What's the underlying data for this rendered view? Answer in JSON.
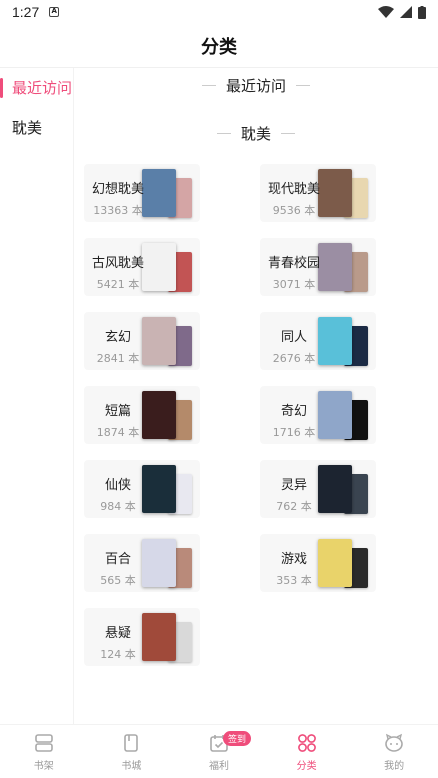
{
  "status_bar": {
    "time": "1:27",
    "notification_icon": "A"
  },
  "header": {
    "title": "分类"
  },
  "sidebar": {
    "items": [
      {
        "label": "最近访问",
        "active": true
      },
      {
        "label": "耽美",
        "active": false
      }
    ]
  },
  "sections": {
    "recent": {
      "title": "最近访问"
    },
    "danmei": {
      "title": "耽美"
    }
  },
  "categories": [
    {
      "name": "幻想耽美",
      "count": "13363 本",
      "front": "#5a7fa8",
      "back": "#d4a5a5"
    },
    {
      "name": "现代耽美",
      "count": "9536 本",
      "front": "#7c5b4a",
      "back": "#e8d7b0"
    },
    {
      "name": "古风耽美",
      "count": "5421 本",
      "front": "#f2f2f2",
      "back": "#c25454"
    },
    {
      "name": "青春校园",
      "count": "3071 本",
      "front": "#9b8ea3",
      "back": "#b99a8a"
    },
    {
      "name": "玄幻",
      "count": "2841 本",
      "front": "#c9b3b3",
      "back": "#7f6a8a"
    },
    {
      "name": "同人",
      "count": "2676 本",
      "front": "#59c0d9",
      "back": "#1b2a44"
    },
    {
      "name": "短篇",
      "count": "1874 本",
      "front": "#3a1d1d",
      "back": "#b48a6a"
    },
    {
      "name": "奇幻",
      "count": "1716 本",
      "front": "#8fa6c9",
      "back": "#111111"
    },
    {
      "name": "仙侠",
      "count": "984 本",
      "front": "#1a2e3a",
      "back": "#e8e8f0"
    },
    {
      "name": "灵异",
      "count": "762 本",
      "front": "#1c2430",
      "back": "#3a4450"
    },
    {
      "name": "百合",
      "count": "565 本",
      "front": "#d6d8e8",
      "back": "#b98a7a"
    },
    {
      "name": "游戏",
      "count": "353 本",
      "front": "#e9d36a",
      "back": "#2a2a2a"
    },
    {
      "name": "悬疑",
      "count": "124 本",
      "front": "#a04a3a",
      "back": "#d9d9d9"
    }
  ],
  "tabbar": {
    "items": [
      {
        "label": "书架",
        "icon": "bookshelf-icon",
        "active": false
      },
      {
        "label": "书城",
        "icon": "book-icon",
        "active": false
      },
      {
        "label": "福利",
        "icon": "calendar-check-icon",
        "active": false,
        "badge": "签到"
      },
      {
        "label": "分类",
        "icon": "grid-circles-icon",
        "active": true
      },
      {
        "label": "我的",
        "icon": "profile-face-icon",
        "active": false
      }
    ]
  },
  "colors": {
    "accent": "#ef4d7b",
    "muted": "#999999",
    "card_bg": "#f7f7f7"
  }
}
